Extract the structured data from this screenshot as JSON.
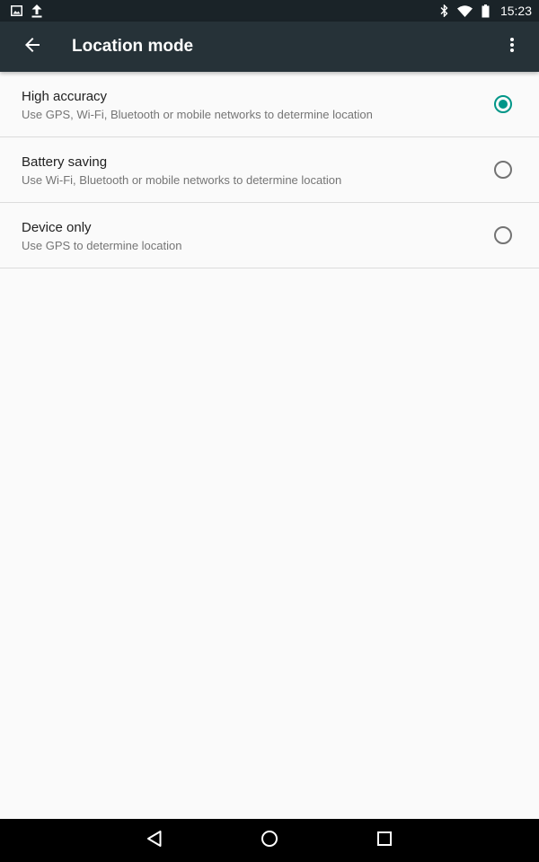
{
  "status_bar": {
    "time": "15:23",
    "left_icons": [
      "image-notification-icon",
      "upload-icon"
    ],
    "right_icons": [
      "bluetooth-icon",
      "wifi-icon",
      "battery-icon"
    ]
  },
  "app_bar": {
    "title": "Location mode",
    "back_icon": "arrow-back-icon",
    "overflow_icon": "more-vert-icon"
  },
  "options": [
    {
      "title": "High accuracy",
      "summary": "Use GPS, Wi-Fi, Bluetooth or mobile networks to determine location",
      "selected": true
    },
    {
      "title": "Battery saving",
      "summary": "Use Wi-Fi, Bluetooth or mobile networks to determine location",
      "selected": false
    },
    {
      "title": "Device only",
      "summary": "Use GPS to determine location",
      "selected": false
    }
  ],
  "nav_bar": {
    "buttons": [
      "back-triangle-icon",
      "home-circle-icon",
      "recents-square-icon"
    ]
  },
  "colors": {
    "status_bar": "#1a2328",
    "app_bar": "#263238",
    "accent": "#009688",
    "background": "#fafafa"
  }
}
